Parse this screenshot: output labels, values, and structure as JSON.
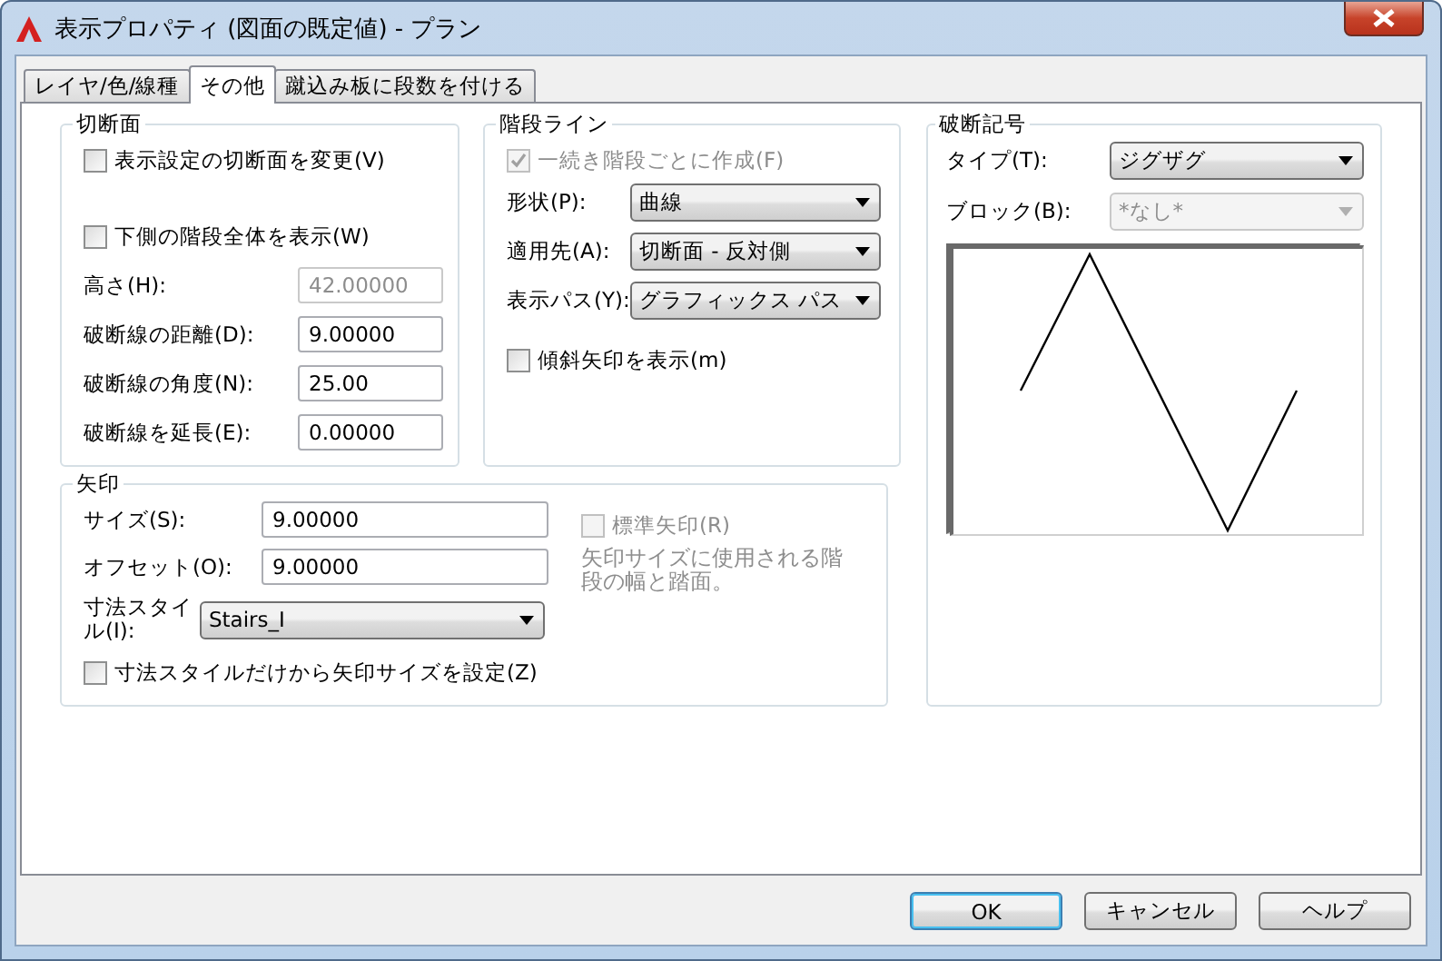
{
  "window": {
    "title": "表示プロパティ (図面の既定値) - プラン"
  },
  "tabs": [
    {
      "label": "レイヤ/色/線種",
      "selected": false
    },
    {
      "label": "その他",
      "selected": true
    },
    {
      "label": "蹴込み板に段数を付ける",
      "selected": false
    }
  ],
  "groups": [
    {
      "title": "切断面",
      "controls": [
        {
          "kind": "checkbox",
          "label": "表示設定の切断面を変更(V)",
          "checked": false,
          "disabled": false
        },
        {
          "kind": "checkbox",
          "label": "下側の階段全体を表示(W)",
          "checked": false,
          "disabled": false
        },
        {
          "kind": "field",
          "label": "高さ(H):",
          "value": "42.00000",
          "disabled": true
        },
        {
          "kind": "field",
          "label": "破断線の距離(D):",
          "value": "9.00000",
          "disabled": false
        },
        {
          "kind": "field",
          "label": "破断線の角度(N):",
          "value": "25.00",
          "disabled": false
        },
        {
          "kind": "field",
          "label": "破断線を延長(E):",
          "value": "0.00000",
          "disabled": false
        }
      ]
    },
    {
      "title": "階段ライン",
      "controls": [
        {
          "kind": "checkbox",
          "label": "一続き階段ごとに作成(F)",
          "checked": true,
          "disabled": true
        },
        {
          "kind": "dropdown",
          "label": "形状(P):",
          "value": "曲線",
          "disabled": false
        },
        {
          "kind": "dropdown",
          "label": "適用先(A):",
          "value": "切断面 - 反対側",
          "disabled": false
        },
        {
          "kind": "dropdown",
          "label": "表示パス(Y):",
          "value": "グラフィックス パス",
          "disabled": false
        },
        {
          "kind": "checkbox",
          "label": "傾斜矢印を表示(m)",
          "checked": false,
          "disabled": false
        }
      ]
    },
    {
      "title": "破断記号",
      "controls": [
        {
          "kind": "dropdown",
          "label": "タイプ(T):",
          "value": "ジグザグ",
          "disabled": false
        },
        {
          "kind": "dropdown",
          "label": "ブロック(B):",
          "value": "*なし*",
          "disabled": true
        },
        {
          "kind": "preview"
        }
      ]
    },
    {
      "title": "矢印",
      "controls": [
        {
          "kind": "field",
          "label": "サイズ(S):",
          "value": "9.00000",
          "disabled": false
        },
        {
          "kind": "field",
          "label": "オフセット(O):",
          "value": "9.00000",
          "disabled": false
        },
        {
          "kind": "dropdown",
          "label": "寸法スタイル(I):",
          "value": "Stairs_I",
          "disabled": false
        },
        {
          "kind": "checkbox",
          "label": "寸法スタイルだけから矢印サイズを設定(Z)",
          "checked": false,
          "disabled": false
        }
      ],
      "aside": [
        {
          "kind": "checkbox",
          "label": "標準矢印(R)",
          "checked": false,
          "disabled": true
        },
        {
          "kind": "note",
          "text": "矢印サイズに使用される階段の幅と踏面。",
          "disabled": true
        }
      ]
    }
  ],
  "buttons": [
    {
      "label": "OK",
      "default": true
    },
    {
      "label": "キャンセル",
      "default": false
    },
    {
      "label": "ヘルプ",
      "default": false
    }
  ]
}
